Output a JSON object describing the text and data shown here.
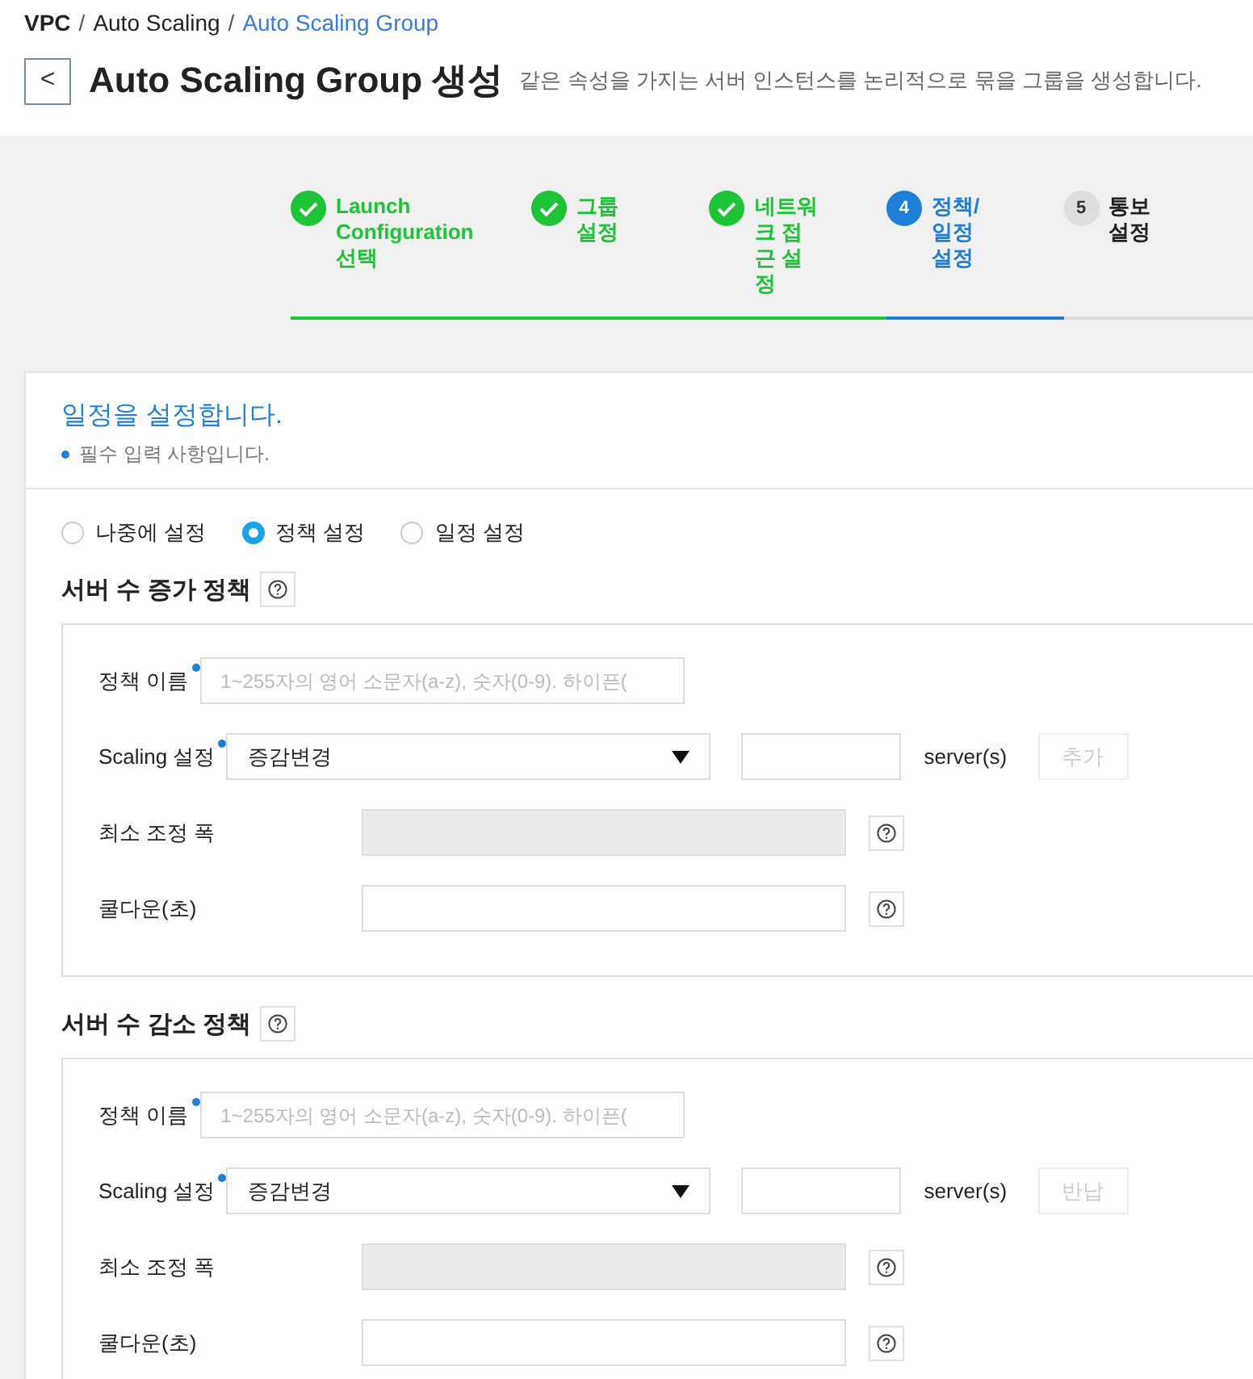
{
  "breadcrumb": [
    {
      "label": "VPC",
      "separator": "/",
      "current": false,
      "bold": true
    },
    {
      "label": "Auto Scaling",
      "separator": "/",
      "current": false,
      "bold": false
    },
    {
      "label": "Auto Scaling Group",
      "current": true,
      "bold": false
    }
  ],
  "page": {
    "back": "<",
    "title": "Auto Scaling Group 생성",
    "subtitle": "같은 속성을 가지는 서버 인스턴스를 논리적으로 묶을 그룹을 생성합니다."
  },
  "steps": [
    {
      "label": "Launch Configuration 선택",
      "done": true,
      "selected": false
    },
    {
      "label": "그룹 설정",
      "done": true,
      "selected": false
    },
    {
      "label": "네트워크 접근 설정",
      "done": true,
      "selected": false
    },
    {
      "number": "4",
      "label": "정책/일정 설정",
      "done": false,
      "selected": true
    },
    {
      "number": "5",
      "label": "통보 설정",
      "done": false,
      "selected": false
    }
  ],
  "card": {
    "title": "일정을 설정합니다.",
    "required_note": "필수 입력 사항입니다."
  },
  "mode_options": [
    {
      "label": "나중에 설정",
      "selected": false
    },
    {
      "label": "정책 설정",
      "selected": true
    },
    {
      "label": "일정 설정",
      "selected": false
    }
  ],
  "policies": [
    {
      "title": "서버 수 증가 정책",
      "name_label": "정책 이름",
      "name_placeholder": "1~255자의 영어 소문자(a-z), 숫자(0-9). 하이픈(",
      "scaling_label": "Scaling 설정",
      "scaling_value": "증감변경",
      "unit": "server(s)",
      "action": "추가",
      "min_label": "최소 조정 폭",
      "cooldown_label": "쿨다운(초)"
    },
    {
      "title": "서버 수 감소 정책",
      "name_label": "정책 이름",
      "name_placeholder": "1~255자의 영어 소문자(a-z), 숫자(0-9). 하이픈(",
      "scaling_label": "Scaling 설정",
      "scaling_value": "증감변경",
      "unit": "server(s)",
      "action": "반납",
      "min_label": "최소 조정 폭",
      "cooldown_label": "쿨다운(초)"
    }
  ]
}
